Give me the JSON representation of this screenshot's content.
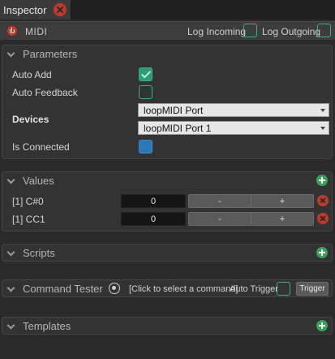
{
  "tab": {
    "label": "Inspector"
  },
  "header": {
    "title": "MIDI",
    "log_incoming_label": "Log Incoming",
    "log_outgoing_label": "Log Outgoing"
  },
  "parameters": {
    "title": "Parameters",
    "auto_add_label": "Auto Add",
    "auto_add_checked": true,
    "auto_feedback_label": "Auto Feedback",
    "auto_feedback_checked": false,
    "devices_label": "Devices",
    "device_in": "loopMIDI Port",
    "device_out": "loopMIDI Port 1",
    "is_connected_label": "Is Connected",
    "is_connected": true
  },
  "values": {
    "title": "Values",
    "rows": [
      {
        "label": "[1] C#0",
        "value": "0",
        "minus": "-",
        "plus": "+"
      },
      {
        "label": "[1] CC1",
        "value": "0",
        "minus": "-",
        "plus": "+"
      }
    ]
  },
  "scripts": {
    "title": "Scripts"
  },
  "command_tester": {
    "title": "Command Tester",
    "command_placeholder": "[Click to select a command]",
    "auto_trigger_label": "Auto Trigger",
    "trigger_label": "Trigger"
  },
  "templates": {
    "title": "Templates"
  },
  "colors": {
    "accent_green": "#3fae86",
    "remove_red": "#c0392b",
    "connected_blue": "#2b78b6"
  }
}
